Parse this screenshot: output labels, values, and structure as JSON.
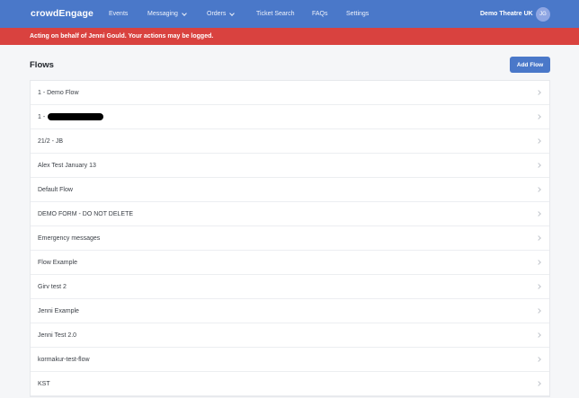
{
  "header": {
    "brand": "crowdEngage",
    "nav": [
      {
        "label": "Events",
        "has_dropdown": false
      },
      {
        "label": "Messaging",
        "has_dropdown": true
      },
      {
        "label": "Orders",
        "has_dropdown": true
      },
      {
        "label": "Ticket Search",
        "has_dropdown": false
      },
      {
        "label": "FAQs",
        "has_dropdown": false
      },
      {
        "label": "Settings",
        "has_dropdown": false
      }
    ],
    "org_name": "Demo Theatre UK",
    "avatar_initials": "JG",
    "colors": {
      "nav_bg": "#4a78c9",
      "avatar_bg": "#8fa6e3"
    }
  },
  "banner": {
    "text": "Acting on behalf of Jenni Gould. Your actions may be logged.",
    "color": "#d9423f"
  },
  "main": {
    "title": "Flows",
    "add_button_label": "Add Flow",
    "flows": [
      {
        "label": "1 - Demo Flow"
      },
      {
        "label": "1 -",
        "redacted": true
      },
      {
        "label": "21/2 - JB"
      },
      {
        "label": "Alex Test January 13"
      },
      {
        "label": "Default Flow"
      },
      {
        "label": "DEMO FORM - DO NOT DELETE"
      },
      {
        "label": "Emergency messages"
      },
      {
        "label": "Flow Example"
      },
      {
        "label": "Girv test 2"
      },
      {
        "label": "Jenni Example"
      },
      {
        "label": "Jenni Test 2.0"
      },
      {
        "label": "kormakur-test-flow"
      },
      {
        "label": "KST"
      }
    ],
    "row_icon": "chevron-right-icon"
  }
}
